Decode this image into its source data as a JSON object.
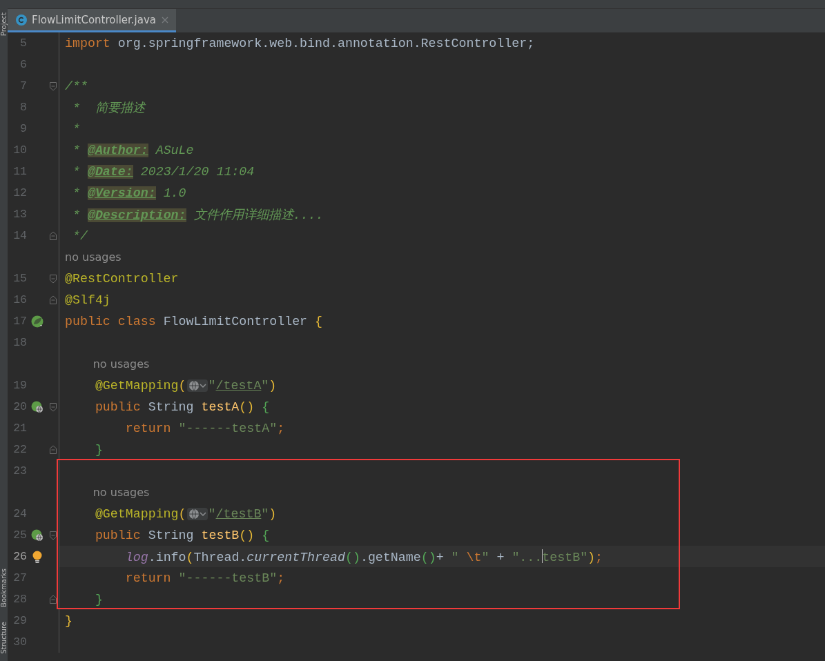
{
  "tool_strip": [
    {
      "label": "Project"
    },
    {
      "label": "Bookmarks"
    },
    {
      "label": "Structure"
    }
  ],
  "tabs": [
    {
      "label": "FlowLimitController.java",
      "selected": true
    }
  ],
  "editor": {
    "rows": [
      {
        "kind": "code",
        "number": "5",
        "current": false,
        "tokens": [
          {
            "text": "import",
            "kind": "keyword"
          },
          {
            "text": " org.springframework.web.bind.annotation.RestController;",
            "kind": "plain"
          }
        ]
      },
      {
        "kind": "code",
        "number": "6",
        "current": false
      },
      {
        "kind": "code",
        "number": "7",
        "current": false,
        "markers": [
          {
            "kind": "fold-start"
          }
        ],
        "tokens": [
          {
            "text": "/**",
            "kind": "comment"
          }
        ]
      },
      {
        "kind": "code",
        "number": "8",
        "current": false,
        "tokens": [
          {
            "text": " *  简要描述",
            "kind": "comment"
          }
        ]
      },
      {
        "kind": "code",
        "number": "9",
        "current": false,
        "tokens": [
          {
            "text": " *",
            "kind": "comment"
          }
        ]
      },
      {
        "kind": "code",
        "number": "10",
        "current": false,
        "tokens": [
          {
            "text": " * ",
            "kind": "comment"
          },
          {
            "text": "@Author:",
            "kind": "doc-tag"
          },
          {
            "text": " ASuLe",
            "kind": "comment"
          }
        ]
      },
      {
        "kind": "code",
        "number": "11",
        "current": false,
        "tokens": [
          {
            "text": " * ",
            "kind": "comment"
          },
          {
            "text": "@Date:",
            "kind": "doc-tag"
          },
          {
            "text": " 2023/1/20 11:04",
            "kind": "comment"
          }
        ]
      },
      {
        "kind": "code",
        "number": "12",
        "current": false,
        "tokens": [
          {
            "text": " * ",
            "kind": "comment"
          },
          {
            "text": "@Version:",
            "kind": "doc-tag"
          },
          {
            "text": " 1.0",
            "kind": "comment"
          }
        ]
      },
      {
        "kind": "code",
        "number": "13",
        "current": false,
        "tokens": [
          {
            "text": " * ",
            "kind": "comment"
          },
          {
            "text": "@Description:",
            "kind": "doc-tag"
          },
          {
            "text": " 文件作用详细描述....",
            "kind": "comment"
          }
        ]
      },
      {
        "kind": "code",
        "number": "14",
        "current": false,
        "markers": [
          {
            "kind": "fold-end"
          }
        ],
        "tokens": [
          {
            "text": " */",
            "kind": "comment"
          }
        ]
      },
      {
        "kind": "hint",
        "nested": false,
        "tokens": [
          {
            "text": "no usages",
            "kind": "hint"
          }
        ]
      },
      {
        "kind": "code",
        "number": "15",
        "current": false,
        "markers": [
          {
            "kind": "fold-start"
          }
        ],
        "tokens": [
          {
            "text": "@RestController",
            "kind": "annotation"
          }
        ]
      },
      {
        "kind": "code",
        "number": "16",
        "current": false,
        "markers": [
          {
            "kind": "fold-end"
          }
        ],
        "tokens": [
          {
            "text": "@Slf4j",
            "kind": "annotation"
          }
        ]
      },
      {
        "kind": "code",
        "number": "17",
        "current": false,
        "markers": [
          {
            "kind": "spring-bean"
          }
        ],
        "tokens": [
          {
            "text": "public class",
            "kind": "keyword"
          },
          {
            "text": " FlowLimitController ",
            "kind": "plain"
          },
          {
            "text": "{",
            "kind": "bracket-yellow"
          }
        ]
      },
      {
        "kind": "code",
        "number": "18",
        "current": false
      },
      {
        "kind": "hint",
        "nested": true,
        "tokens": [
          {
            "text": "no usages",
            "kind": "hint"
          }
        ]
      },
      {
        "kind": "code",
        "number": "19",
        "current": false,
        "tokens": [
          {
            "text": "    @GetMapping",
            "kind": "annotation"
          },
          {
            "text": "(",
            "kind": "bracket-yellow"
          },
          {
            "kind": "inlay-globe"
          },
          {
            "text": "\"",
            "kind": "string"
          },
          {
            "text": "/testA",
            "kind": "string-link"
          },
          {
            "text": "\"",
            "kind": "string"
          },
          {
            "text": ")",
            "kind": "bracket-yellow"
          }
        ]
      },
      {
        "kind": "code",
        "number": "20",
        "current": false,
        "markers": [
          {
            "kind": "spring-web"
          },
          {
            "kind": "fold-start"
          }
        ],
        "tokens": [
          {
            "text": "    public",
            "kind": "keyword"
          },
          {
            "text": " String ",
            "kind": "plain"
          },
          {
            "text": "testA",
            "kind": "method"
          },
          {
            "text": "() ",
            "kind": "bracket-yellow"
          },
          {
            "text": "{",
            "kind": "bracket-green"
          }
        ]
      },
      {
        "kind": "code",
        "number": "21",
        "current": false,
        "tokens": [
          {
            "text": "        return",
            "kind": "keyword"
          },
          {
            "text": " \"------testA\"",
            "kind": "string"
          },
          {
            "text": ";",
            "kind": "keyword"
          }
        ]
      },
      {
        "kind": "code",
        "number": "22",
        "current": false,
        "markers": [
          {
            "kind": "fold-end"
          }
        ],
        "tokens": [
          {
            "text": "    }",
            "kind": "bracket-green"
          }
        ]
      },
      {
        "kind": "code",
        "number": "23",
        "current": false
      },
      {
        "kind": "hint",
        "nested": true,
        "tokens": [
          {
            "text": "no usages",
            "kind": "hint"
          }
        ]
      },
      {
        "kind": "code",
        "number": "24",
        "current": false,
        "tokens": [
          {
            "text": "    @GetMapping",
            "kind": "annotation"
          },
          {
            "text": "(",
            "kind": "bracket-yellow"
          },
          {
            "kind": "inlay-globe"
          },
          {
            "text": "\"",
            "kind": "string"
          },
          {
            "text": "/testB",
            "kind": "string-link"
          },
          {
            "text": "\"",
            "kind": "string"
          },
          {
            "text": ")",
            "kind": "bracket-yellow"
          }
        ]
      },
      {
        "kind": "code",
        "number": "25",
        "current": false,
        "markers": [
          {
            "kind": "spring-web"
          },
          {
            "kind": "fold-start"
          }
        ],
        "tokens": [
          {
            "text": "    public",
            "kind": "keyword"
          },
          {
            "text": " String ",
            "kind": "plain"
          },
          {
            "text": "testB",
            "kind": "method"
          },
          {
            "text": "() ",
            "kind": "bracket-yellow"
          },
          {
            "text": "{",
            "kind": "bracket-green"
          }
        ]
      },
      {
        "kind": "code",
        "number": "26",
        "current": true,
        "markers": [
          {
            "kind": "bulb"
          }
        ],
        "tokens": [
          {
            "text": "        log",
            "kind": "field-italic"
          },
          {
            "text": ".info",
            "kind": "plain"
          },
          {
            "text": "(",
            "kind": "bracket-yellow"
          },
          {
            "text": "Thread.",
            "kind": "plain"
          },
          {
            "text": "currentThread",
            "kind": "call-italic"
          },
          {
            "text": "()",
            "kind": "bracket-green"
          },
          {
            "text": ".getName",
            "kind": "plain"
          },
          {
            "text": "()",
            "kind": "bracket-green"
          },
          {
            "text": "+ ",
            "kind": "plain"
          },
          {
            "text": "\" ",
            "kind": "string"
          },
          {
            "text": "\\t",
            "kind": "escape"
          },
          {
            "text": "\"",
            "kind": "string"
          },
          {
            "text": " + ",
            "kind": "plain"
          },
          {
            "text": "\"...",
            "kind": "string"
          },
          {
            "kind": "caret"
          },
          {
            "text": "testB\"",
            "kind": "string"
          },
          {
            "text": ")",
            "kind": "bracket-yellow"
          },
          {
            "text": ";",
            "kind": "keyword"
          }
        ]
      },
      {
        "kind": "code",
        "number": "27",
        "current": false,
        "tokens": [
          {
            "text": "        return",
            "kind": "keyword"
          },
          {
            "text": " \"------testB\"",
            "kind": "string"
          },
          {
            "text": ";",
            "kind": "keyword"
          }
        ]
      },
      {
        "kind": "code",
        "number": "28",
        "current": false,
        "markers": [
          {
            "kind": "fold-end"
          }
        ],
        "tokens": [
          {
            "text": "    }",
            "kind": "bracket-green"
          }
        ]
      },
      {
        "kind": "code",
        "number": "29",
        "current": false,
        "tokens": [
          {
            "text": "}",
            "kind": "bracket-yellow"
          }
        ]
      },
      {
        "kind": "code",
        "number": "30",
        "current": false
      }
    ]
  }
}
